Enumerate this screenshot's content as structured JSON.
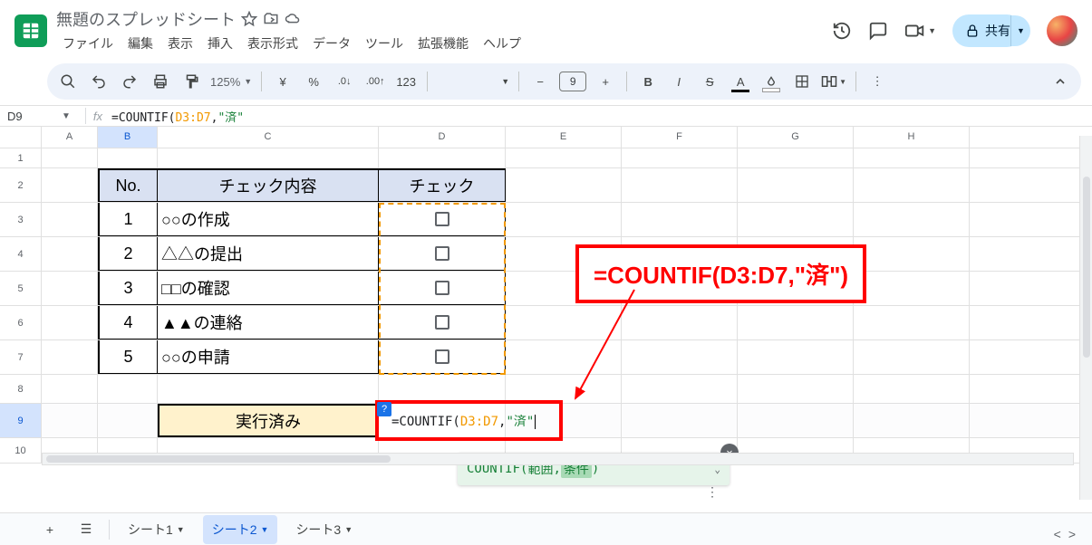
{
  "header": {
    "doc_title": "無題のスプレッドシート",
    "menus": [
      "ファイル",
      "編集",
      "表示",
      "挿入",
      "表示形式",
      "データ",
      "ツール",
      "拡張機能",
      "ヘルプ"
    ],
    "share_label": "共有"
  },
  "toolbar": {
    "zoom": "125%",
    "currency": "¥",
    "percent": "%",
    "dec_less": ".0",
    "dec_more": ".00",
    "num_format": "123",
    "font_size": "9",
    "bold": "B",
    "italic": "I"
  },
  "formula_bar": {
    "name_box": "D9",
    "fx_symbol": "fx",
    "parts": {
      "eq": "=COUNTIF(",
      "range": "D3:D7",
      "comma": ",",
      "str": "\"済\""
    }
  },
  "grid": {
    "cols": [
      "A",
      "B",
      "C",
      "D",
      "E",
      "F",
      "G",
      "H"
    ],
    "row_numbers": [
      "1",
      "2",
      "3",
      "4",
      "5",
      "6",
      "7",
      "8",
      "9",
      "10"
    ],
    "table_headers": {
      "no": "No.",
      "content": "チェック内容",
      "check": "チェック"
    },
    "table_rows": [
      {
        "no": "1",
        "content": "○○の作成"
      },
      {
        "no": "2",
        "content": "△△の提出"
      },
      {
        "no": "3",
        "content": "□□の確認"
      },
      {
        "no": "4",
        "content": "▲▲の連絡"
      },
      {
        "no": "5",
        "content": "○○の申請"
      }
    ],
    "sum_label": "実行済み",
    "d9_parts": {
      "eq": "=COUNTIF(",
      "range": "D3:D7",
      "comma": ",",
      "str": "\"済\""
    }
  },
  "fx_popup": {
    "fn": "COUNTIF",
    "open": "(",
    "arg1": "範囲",
    "sep": ", ",
    "arg2": "条件",
    "close": ")"
  },
  "annotation": {
    "text": "=COUNTIF(D3:D7,\"済\")"
  },
  "sheet_tabs": {
    "tabs": [
      "シート1",
      "シート2",
      "シート3"
    ],
    "active_index": 1
  }
}
